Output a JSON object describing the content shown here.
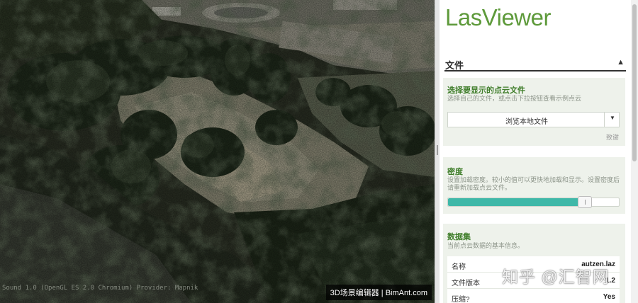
{
  "viewport": {
    "status_text": "Sound 1.0 (OpenGL ES 2.0 Chromium) Provider: Mapnik",
    "brand_badge": "3D场景编辑器 | BimAnt.com"
  },
  "sidebar": {
    "app_title": "LasViewer",
    "section": {
      "label": "文件",
      "chevron_icon": "chevron-up-icon"
    },
    "file_panel": {
      "title": "选择要显示的点云文件",
      "description": "选择自己的文件，或点击下拉按钮查看示例点云",
      "browse_label": "浏览本地文件",
      "dropdown_icon": "caret-down-icon",
      "thanks_label": "致谢"
    },
    "density_panel": {
      "title": "密度",
      "description": "设置加载密度。较小的值可以更快地加载和显示。设置密度后请重新加载点云文件。",
      "value_fraction": 0.8
    },
    "dataset_panel": {
      "title": "数据集",
      "description": "当前点云数据的基本信息。",
      "rows": [
        {
          "key": "名称",
          "value": "autzen.laz"
        },
        {
          "key": "文件版本",
          "value": "1.2"
        },
        {
          "key": "压缩?",
          "value": "Yes"
        }
      ]
    }
  },
  "watermark": "知乎 @汇智网",
  "colors": {
    "brand_green": "#5e9a3b",
    "slider_fill": "#3fb8a8",
    "panel_bg": "#eef2eb"
  }
}
